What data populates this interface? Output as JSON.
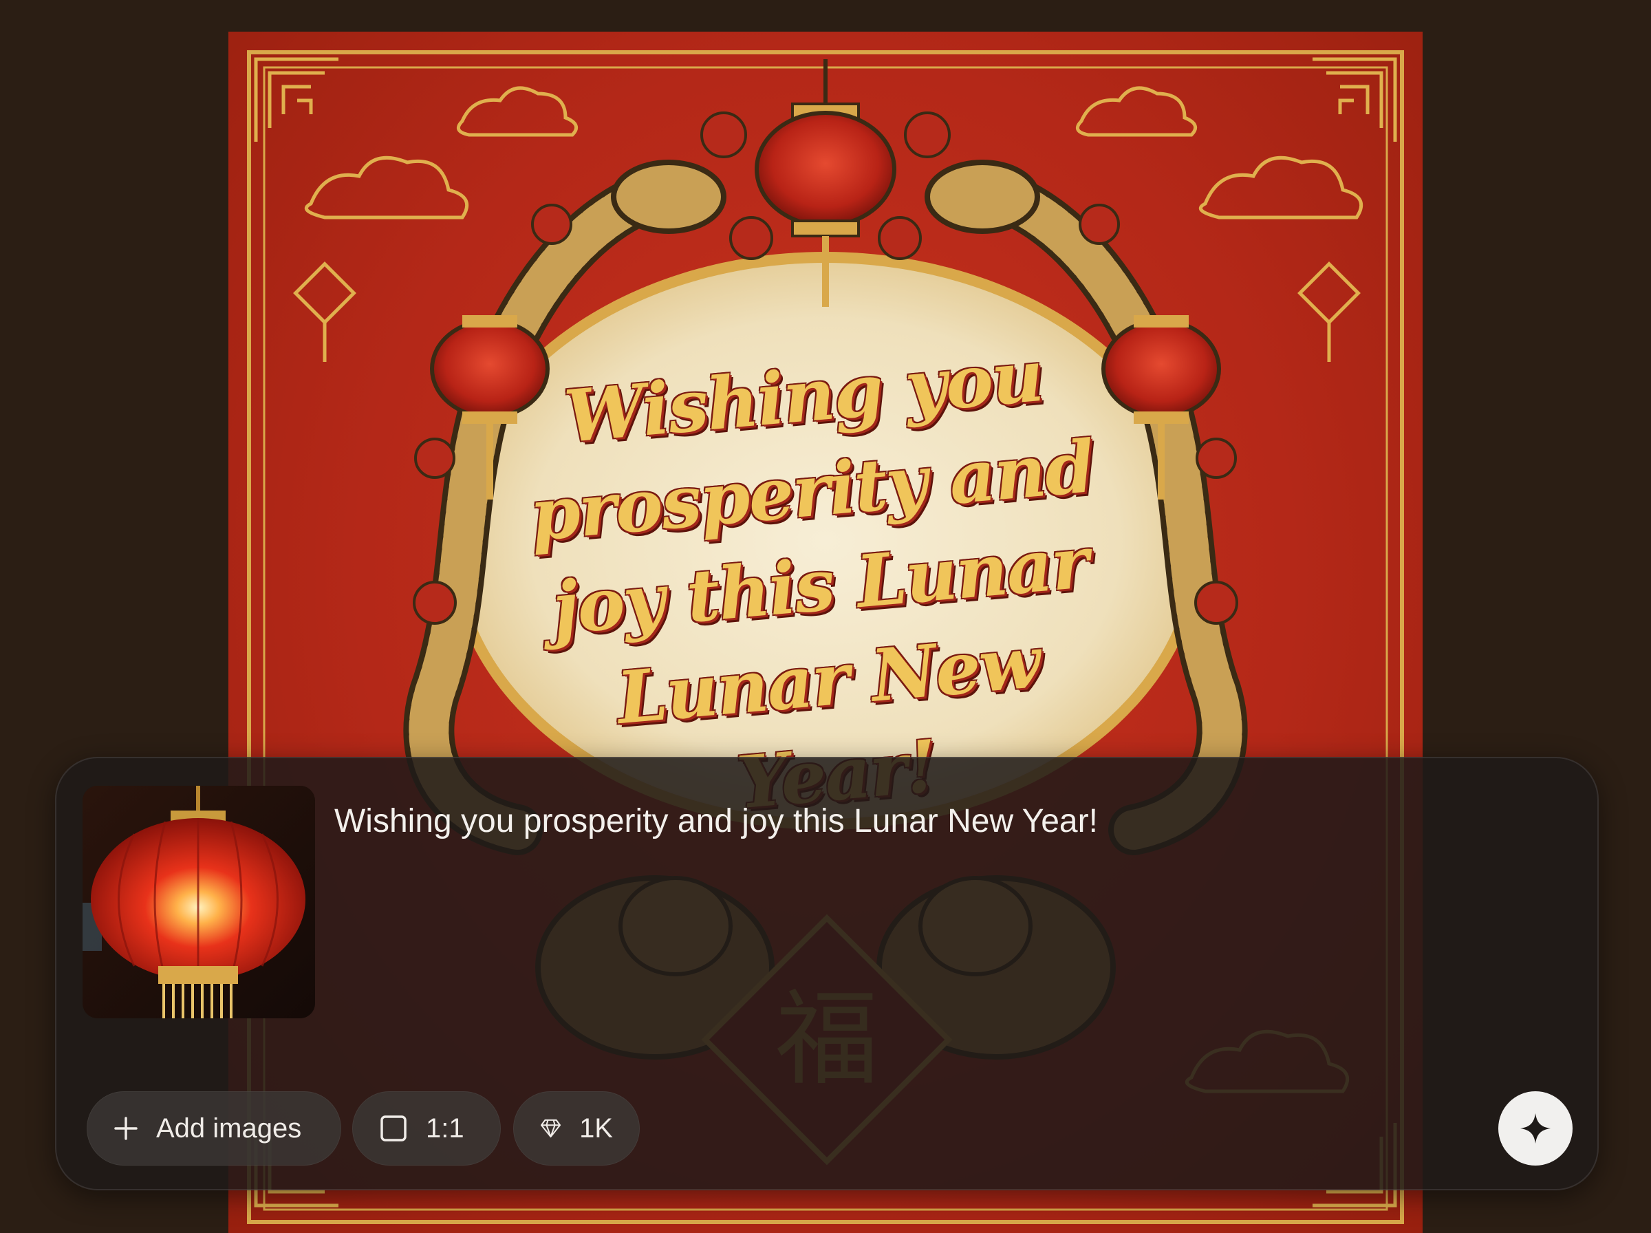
{
  "poster": {
    "greeting_lines": [
      "Wishing you",
      "prosperity and",
      "joy this Lunar",
      "Lunar New Year!"
    ],
    "center_character": "福"
  },
  "prompt": {
    "text": "Wishing you prosperity and joy this Lunar New Year!",
    "thumbnail_icon": "red-lantern-thumbnail"
  },
  "toolbar": {
    "add_images_label": "Add images",
    "add_icon": "plus-icon",
    "aspect_ratio_label": "1:1",
    "aspect_icon": "square-icon",
    "resolution_label": "1K",
    "resolution_icon": "diamond-icon",
    "generate_icon": "sparkle-icon"
  },
  "colors": {
    "background": "#2b1e14",
    "poster_red": "#b42818",
    "gold": "#e0b04e",
    "cream": "#f2e6c8",
    "panel": "#1e1a18",
    "chip": "#3c3836",
    "generate_button": "#f1f0ee"
  }
}
